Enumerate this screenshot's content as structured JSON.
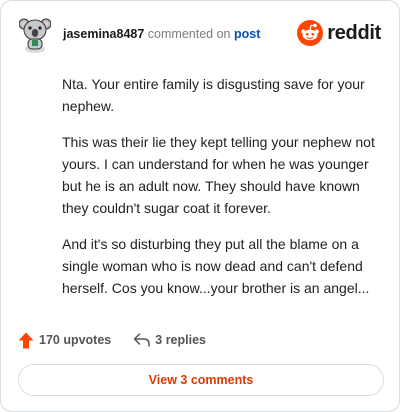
{
  "comment": {
    "username": "jasemina8487",
    "action_text": "commented on",
    "post_link": "post",
    "paragraphs": [
      "Nta. Your entire family is disgusting save for your nephew.",
      "This was their lie they kept telling your nephew not yours. I can understand for when he was younger but he is an adult now. They should have known they couldn't sugar coat it forever.",
      "And it's so disturbing they put all the blame on a single woman who is now dead and can't defend herself. Cos you know...your brother is an angel..."
    ],
    "upvotes": "170 upvotes",
    "replies": "3 replies",
    "view_comments": "View 3 comments"
  },
  "brand": {
    "name": "reddit",
    "accent": "#ff4500"
  },
  "colors": {
    "upvote": "#ff4500",
    "link": "#0a4fb0",
    "view_button_text": "#d93a00"
  },
  "icons": [
    "avatar-koala",
    "reddit-logo-icon",
    "upvote-arrow-icon",
    "reply-arrow-icon"
  ]
}
